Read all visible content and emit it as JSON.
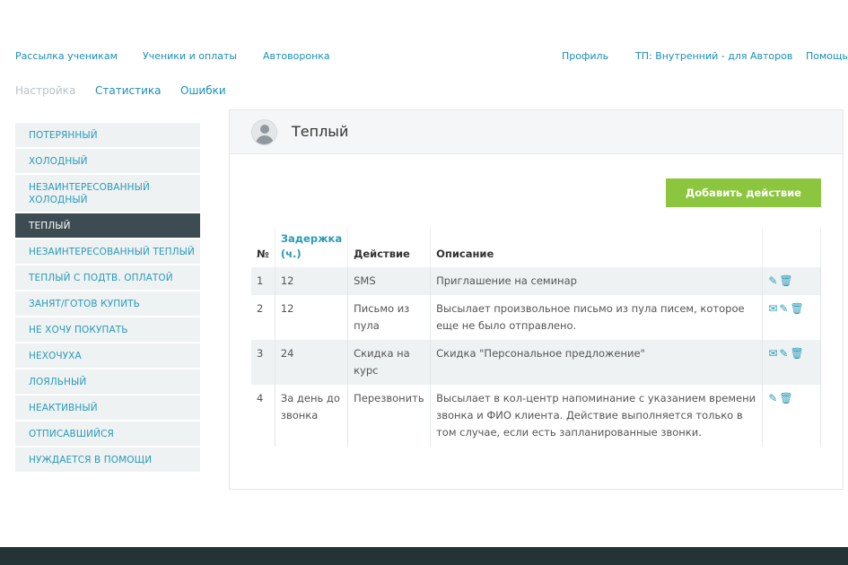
{
  "topnav": {
    "mailing": "Рассылка ученикам",
    "students": "Ученики и оплаты",
    "autofunnel": "Автоворонка",
    "profile": "Профиль",
    "tp": "ТП: Внутренний - для Авторов",
    "help": "Помощь"
  },
  "subnav": {
    "settings": "Настройка",
    "stats": "Статистика",
    "errors": "Ошибки"
  },
  "sidebar": {
    "items": [
      {
        "label": "ПОТЕРЯННЫЙ"
      },
      {
        "label": "ХОЛОДНЫЙ"
      },
      {
        "label": "НЕЗАИНТЕРЕСОВАННЫЙ ХОЛОДНЫЙ"
      },
      {
        "label": "ТЕПЛЫЙ"
      },
      {
        "label": "НЕЗАИНТЕРЕСОВАННЫЙ ТЕПЛЫЙ"
      },
      {
        "label": "ТЕПЛЫЙ С ПОДТВ. ОПЛАТОЙ"
      },
      {
        "label": "ЗАНЯТ/ГОТОВ КУПИТЬ"
      },
      {
        "label": "НЕ ХОЧУ ПОКУПАТЬ"
      },
      {
        "label": "НЕХОЧУХА"
      },
      {
        "label": "ЛОЯЛЬНЫЙ"
      },
      {
        "label": "НЕАКТИВНЫЙ"
      },
      {
        "label": "ОТПИСАВШИЙСЯ"
      },
      {
        "label": "НУЖДАЕТСЯ В ПОМОЩИ"
      }
    ],
    "active_index": 3
  },
  "panel": {
    "title": "Теплый",
    "add_button": "Добавить действие"
  },
  "table": {
    "headers": {
      "num": "№",
      "delay": "Задержка (ч.)",
      "action": "Действие",
      "description": "Описание"
    },
    "rows": [
      {
        "num": "1",
        "delay": "12",
        "action": "SMS",
        "description": "Приглашение на семинар",
        "icons": [
          "edit-icon",
          "delete-icon"
        ]
      },
      {
        "num": "2",
        "delay": "12",
        "action": "Письмо из пула",
        "description": "Высылает произвольное письмо из пула писем, которое еще не было отправлено.",
        "icons": [
          "mail-icon",
          "edit-icon",
          "delete-icon"
        ]
      },
      {
        "num": "3",
        "delay": "24",
        "action": "Скидка на курс",
        "description": "Скидка \"Персональное предложение\"",
        "icons": [
          "mail-icon",
          "edit-icon",
          "delete-icon"
        ]
      },
      {
        "num": "4",
        "delay": "За день до звонка",
        "action": "Перезвонить",
        "description": "Высылает в кол-центр напоминание с указанием времени звонка и ФИО клиента. Действие выполняется только в том случае, если есть запланированные звонки.",
        "icons": [
          "edit-icon",
          "delete-icon"
        ]
      }
    ]
  },
  "colors": {
    "link": "#1a8fb5",
    "accent_green": "#8cc63f",
    "sidebar_active": "#3c4c52",
    "footer": "#243436"
  }
}
